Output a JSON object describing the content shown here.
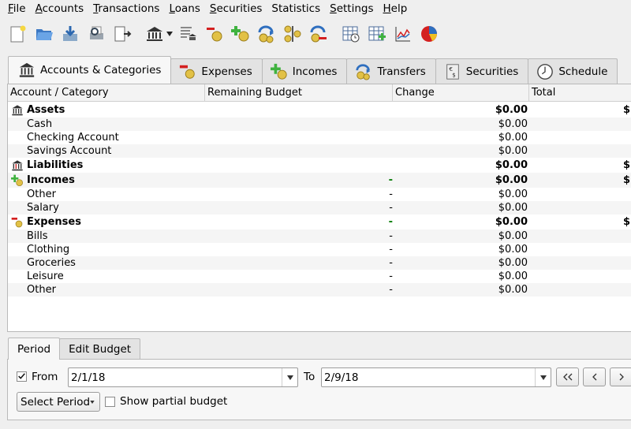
{
  "menu": [
    {
      "u": "F",
      "rest": "ile"
    },
    {
      "u": "A",
      "rest": "ccounts"
    },
    {
      "u": "T",
      "rest": "ransactions"
    },
    {
      "u": "L",
      "rest": "oans"
    },
    {
      "u": "S",
      "rest": "ecurities"
    },
    {
      "u": "",
      "rest": "Statistics"
    },
    {
      "u": "S",
      "rest": "ettings"
    },
    {
      "u": "H",
      "rest": "elp"
    }
  ],
  "toolbar_icons": [
    "new-file-icon",
    "open-folder-icon",
    "save-icon",
    "print-preview-icon",
    "export-icon",
    "bank-account-icon",
    "account-list-icon",
    "new-expense-icon",
    "new-income-icon",
    "new-transfer-icon",
    "split-icon",
    "delete-transaction-icon",
    "schedule-icon",
    "edit-table-icon",
    "line-chart-icon",
    "pie-chart-icon"
  ],
  "tabs": [
    {
      "label": "Accounts & Categories",
      "icon": "bank-icon"
    },
    {
      "label": "Expenses",
      "icon": "expense-icon"
    },
    {
      "label": "Incomes",
      "icon": "income-icon"
    },
    {
      "label": "Transfers",
      "icon": "transfer-icon"
    },
    {
      "label": "Securities",
      "icon": "securities-icon"
    },
    {
      "label": "Schedule",
      "icon": "clock-icon"
    }
  ],
  "columns": {
    "account": "Account / Category",
    "budget": "Remaining Budget",
    "change": "Change",
    "total": "Total"
  },
  "rows": [
    {
      "name": "Assets",
      "top": true,
      "icon": "bank-icon",
      "budget": "",
      "change": "$0.00",
      "total": "$",
      "alt": false
    },
    {
      "name": "Cash",
      "top": false,
      "budget": "",
      "change": "$0.00",
      "total": "",
      "alt": true
    },
    {
      "name": "Checking Account",
      "top": false,
      "budget": "",
      "change": "$0.00",
      "total": "",
      "alt": false
    },
    {
      "name": "Savings Account",
      "top": false,
      "budget": "",
      "change": "$0.00",
      "total": "",
      "alt": true
    },
    {
      "name": "Liabilities",
      "top": true,
      "icon": "liability-icon",
      "budget": "",
      "change": "$0.00",
      "total": "$",
      "alt": false
    },
    {
      "name": "Incomes",
      "top": true,
      "icon": "income-icon",
      "budget": "-",
      "budget_green": true,
      "change": "$0.00",
      "total": "$",
      "alt": true
    },
    {
      "name": "Other",
      "top": false,
      "budget": "-",
      "change": "$0.00",
      "total": "",
      "alt": false
    },
    {
      "name": "Salary",
      "top": false,
      "budget": "-",
      "change": "$0.00",
      "total": "",
      "alt": true
    },
    {
      "name": "Expenses",
      "top": true,
      "icon": "expense-icon",
      "budget": "-",
      "budget_green": true,
      "change": "$0.00",
      "total": "$",
      "alt": false
    },
    {
      "name": "Bills",
      "top": false,
      "budget": "-",
      "change": "$0.00",
      "total": "",
      "alt": true
    },
    {
      "name": "Clothing",
      "top": false,
      "budget": "-",
      "change": "$0.00",
      "total": "",
      "alt": false
    },
    {
      "name": "Groceries",
      "top": false,
      "budget": "-",
      "change": "$0.00",
      "total": "",
      "alt": true
    },
    {
      "name": "Leisure",
      "top": false,
      "budget": "-",
      "change": "$0.00",
      "total": "",
      "alt": false
    },
    {
      "name": "Other",
      "top": false,
      "budget": "-",
      "change": "$0.00",
      "total": "",
      "alt": true
    }
  ],
  "bottom_tabs": [
    "Period",
    "Edit Budget"
  ],
  "period": {
    "from_label": "From",
    "from_checked": true,
    "from_value": "2/1/18",
    "to_label": "To",
    "to_value": "2/9/18",
    "nav_first": "<<",
    "nav_prev": "<",
    "nav_next": ">",
    "select_period": "Select Period",
    "show_partial": "Show partial budget",
    "show_partial_checked": false
  }
}
